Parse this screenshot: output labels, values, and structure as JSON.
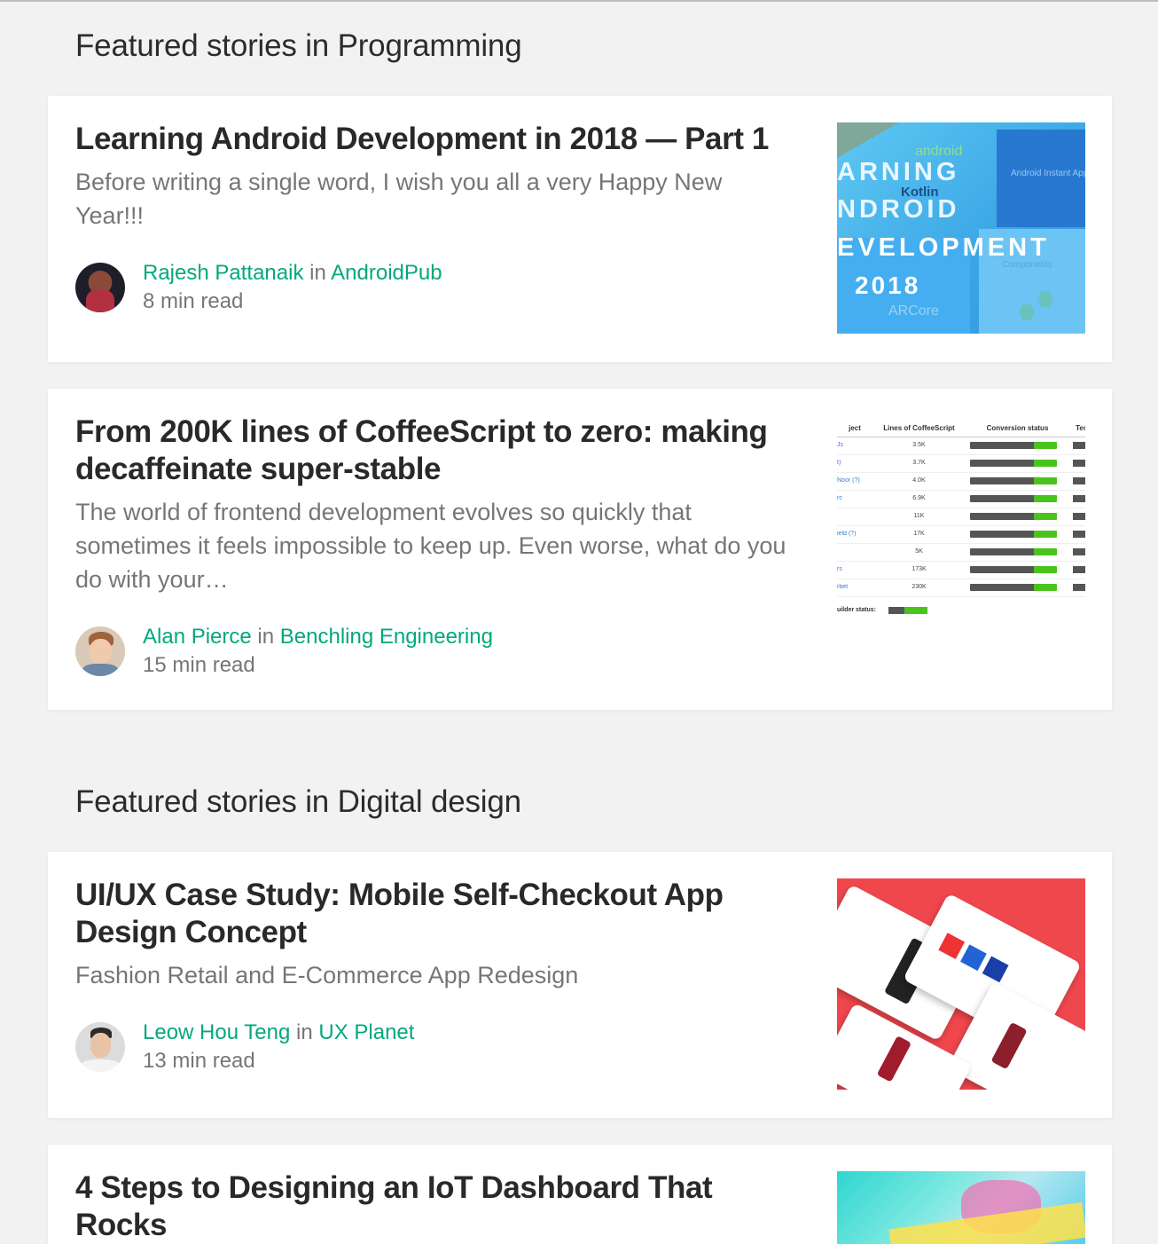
{
  "sections": [
    {
      "title": "Featured stories in Programming",
      "cards": [
        {
          "title": "Learning Android Development in 2018 — Part 1",
          "subtitle": "Before writing a single word, I wish you all a very Happy New Year!!!",
          "author": "Rajesh Pattanaik",
          "in_word": "in",
          "publication": "AndroidPub",
          "read_time": "8 min read",
          "thumb": {
            "line1": "android",
            "line2": "ARNING",
            "line3": "Kotlin",
            "line4": "NDROID",
            "line5": "EVELOPMENT",
            "line6": "2018",
            "line7": "ARCore",
            "side1": "Android Instant Apps",
            "side2": "Components"
          }
        },
        {
          "title": "From 200K lines of CoffeeScript to zero: making decaffeinate super-stable",
          "subtitle": "The world of frontend development evolves so quickly that sometimes it feels impossible to keep up. Even worse, what do you do with your…",
          "author": "Alan Pierce",
          "in_word": "in",
          "publication": "Benchling Engineering",
          "read_time": "15 min read",
          "thumb": {
            "headers": [
              "ject",
              "Lines of CoffeeScript",
              "Conversion status",
              "Test"
            ],
            "rows": [
              [
                "Js",
                "3.5K"
              ],
              [
                "t)",
                "3.7K"
              ],
              [
                "Noor (?)",
                "4.0K"
              ],
              [
                "rc",
                "6.9K"
              ],
              [
                "",
                "11K"
              ],
              [
                "ield (?)",
                "17K"
              ],
              [
                "",
                "5K"
              ],
              [
                "rs",
                "173K"
              ],
              [
                "rbet",
                "230K"
              ]
            ],
            "footer": "uilder status:"
          }
        }
      ]
    },
    {
      "title": "Featured stories in Digital design",
      "cards": [
        {
          "title": "UI/UX Case Study: Mobile Self-Checkout App Design Concept",
          "subtitle": "Fashion Retail and E-Commerce App Redesign",
          "author": "Leow Hou Teng",
          "in_word": "in",
          "publication": "UX Planet",
          "read_time": "13 min read"
        },
        {
          "title": "4 Steps to Designing an IoT Dashboard That Rocks"
        }
      ]
    }
  ],
  "colors": {
    "accent": "#03a87c",
    "background": "#f2f2f2",
    "card": "#ffffff"
  }
}
